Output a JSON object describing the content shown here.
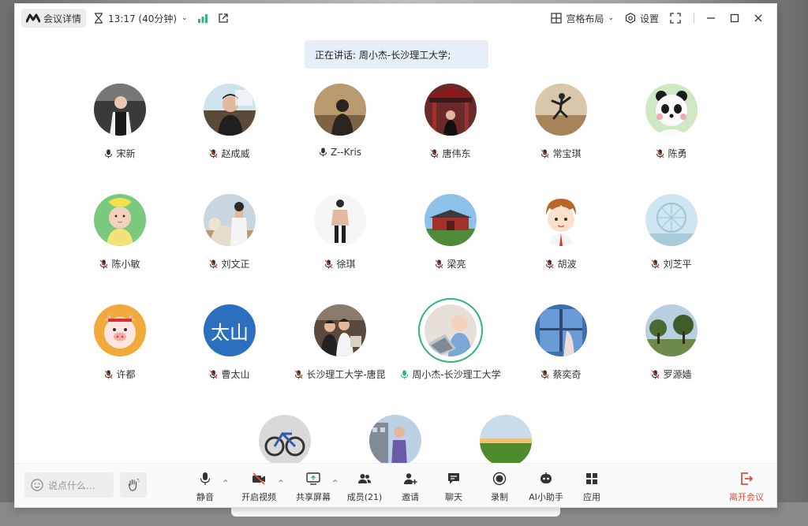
{
  "topbar": {
    "meeting_detail": "会议详情",
    "timer": "13:17 (40分钟)",
    "layout": "宫格布局",
    "settings": "设置"
  },
  "speaking": "正在讲话: 周小杰-长沙理工大学;",
  "participants": [
    {
      "name": "宋新",
      "mic": "on",
      "avatar": "photo-person-hall"
    },
    {
      "name": "赵成威",
      "mic": "muted",
      "avatar": "photo-person-desk"
    },
    {
      "name": "Z--Kris",
      "mic": "on",
      "avatar": "photo-silhouette"
    },
    {
      "name": "唐伟东",
      "mic": "muted",
      "avatar": "photo-graduation"
    },
    {
      "name": "常宝琪",
      "mic": "muted",
      "avatar": "photo-jump-field"
    },
    {
      "name": "陈勇",
      "mic": "muted",
      "avatar": "cartoon-panda"
    },
    {
      "name": "陈小敏",
      "mic": "muted",
      "avatar": "photo-baby"
    },
    {
      "name": "刘文正",
      "mic": "muted",
      "avatar": "photo-alpaca"
    },
    {
      "name": "徐琪",
      "mic": "muted",
      "avatar": "illustration-figure"
    },
    {
      "name": "梁亮",
      "mic": "muted",
      "avatar": "photo-palace"
    },
    {
      "name": "胡波",
      "mic": "muted",
      "avatar": "cartoon-boy"
    },
    {
      "name": "刘芝平",
      "mic": "muted",
      "avatar": "photo-ferris-wheel"
    },
    {
      "name": "许都",
      "mic": "muted",
      "avatar": "cartoon-pig"
    },
    {
      "name": "曹太山",
      "mic": "muted",
      "avatar": "text-avatar",
      "avatar_text": "太山"
    },
    {
      "name": "长沙理工大学-唐昆",
      "mic": "muted",
      "avatar": "photo-children"
    },
    {
      "name": "周小杰-长沙理工大学",
      "mic": "speaking",
      "avatar": "photo-baby-laptop"
    },
    {
      "name": "蔡奕奇",
      "mic": "muted",
      "avatar": "photo-window"
    },
    {
      "name": "罗源嫱",
      "mic": "muted",
      "avatar": "photo-trees"
    },
    {
      "name": "",
      "mic": "",
      "avatar": "photo-bicycle"
    },
    {
      "name": "",
      "mic": "",
      "avatar": "photo-person-building"
    },
    {
      "name": "",
      "mic": "",
      "avatar": "photo-sunset-field"
    }
  ],
  "toolbar": {
    "chat_placeholder": "说点什么...",
    "mute": "静音",
    "video": "开启视频",
    "share": "共享屏幕",
    "members": "成员(21)",
    "invite": "邀请",
    "chat": "聊天",
    "record": "录制",
    "ai": "AI小助手",
    "apps": "应用",
    "leave": "离开会议"
  },
  "colors": {
    "speaking_ring": "#2eb67d",
    "muted_slash": "#e4503a",
    "leave": "#e4503a",
    "banner_bg": "#e6eef9"
  }
}
